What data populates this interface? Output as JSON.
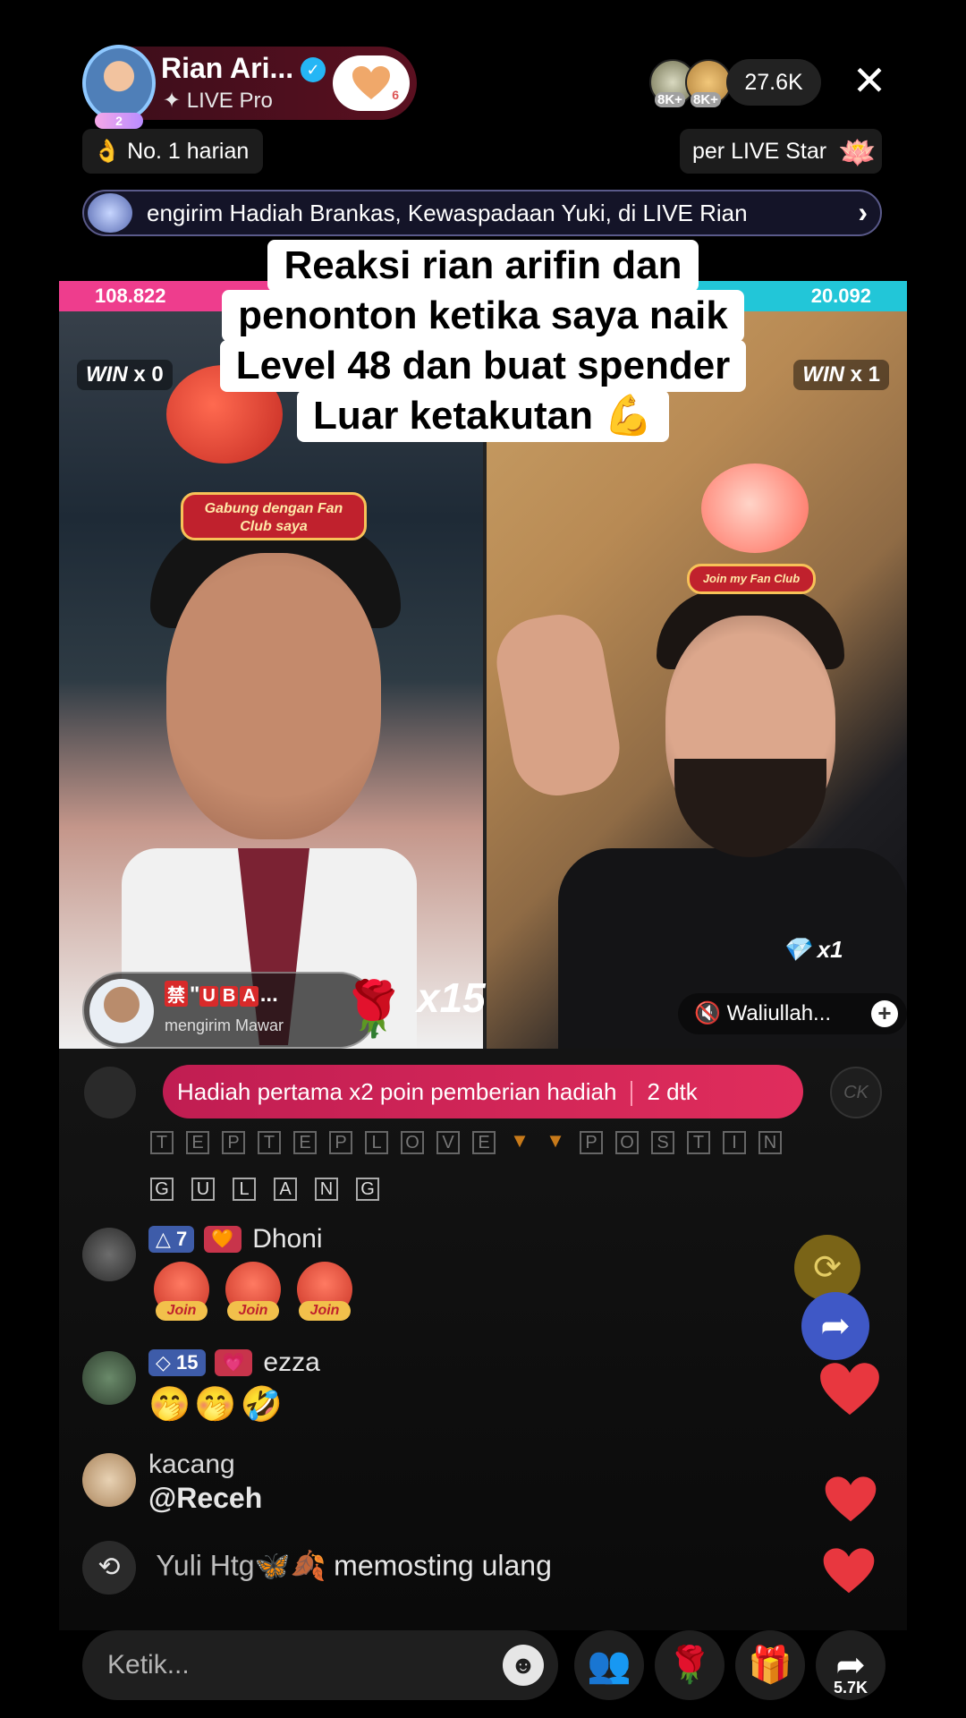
{
  "header": {
    "host_name": "Rian Ari...",
    "host_subtitle": "✦ LIVE Pro",
    "follow_heart_count": "6",
    "viewer_avatar_badges": [
      "8K+",
      "8K+"
    ],
    "viewer_count": "27.6K",
    "close_label": "✕",
    "rank_label": "👌 No. 1 harian",
    "star_label": "per LIVE Star",
    "ticker_text": "engirim Hadiah Brankas, Kewaspadaan Yuki, di LIVE Rian",
    "ticker_arrow": "›"
  },
  "caption": {
    "lines": [
      "Reaksi rian arifin dan",
      "penonton ketika saya naik",
      "Level 48 dan buat spender",
      "Luar ketakutan 💪"
    ]
  },
  "battle": {
    "left_score": "108.822",
    "right_score": "20.092",
    "left_win": "WIN",
    "left_win_count": "x 0",
    "right_win": "WIN",
    "right_win_count": "x 1",
    "left_fanclub": "Gabung dengan Fan Club saya",
    "right_fanclub": "Join my Fan Club",
    "gift_tag_chars": [
      "禁",
      "U",
      "B",
      "A"
    ],
    "gift_user_prefix": "\"",
    "gift_user_suffix": "...",
    "gift_action": "mengirim Mawar",
    "gift_count": "x15",
    "right_gift_count": "x1",
    "guest_name": "Waliullah...",
    "guest_plus": "+"
  },
  "chat": {
    "hint_text": "Hadiah pertama x2 poin pemberian hadiah",
    "hint_timer": "2 dtk",
    "hint_side_right": "CK",
    "letters_row1": [
      "T",
      "E",
      "P",
      "T",
      "E",
      "P",
      "L",
      "O",
      "V",
      "E",
      "▼",
      "▼",
      "P",
      "O",
      "S",
      "T",
      "I",
      "N"
    ],
    "letters_row2": [
      "G",
      "U",
      "L",
      "A",
      "N",
      "G"
    ],
    "messages": [
      {
        "level": "7",
        "name": "Dhoni"
      },
      {
        "level": "15",
        "name": "ezza",
        "emojis": "🤭🤭🤣"
      },
      {
        "name": "kacang",
        "text": "@Receh"
      }
    ],
    "join_label": "Join",
    "repost_user": "Yuli Htg🦋🍂",
    "repost_text": "memosting ulang"
  },
  "bottom": {
    "input_placeholder": "Ketik...",
    "share_count": "5.7K"
  },
  "colors": {
    "score_left": "#ee3d8d",
    "score_right": "#22c6d8",
    "hint_bar": "#d0214f",
    "heart": "#e8373f"
  }
}
